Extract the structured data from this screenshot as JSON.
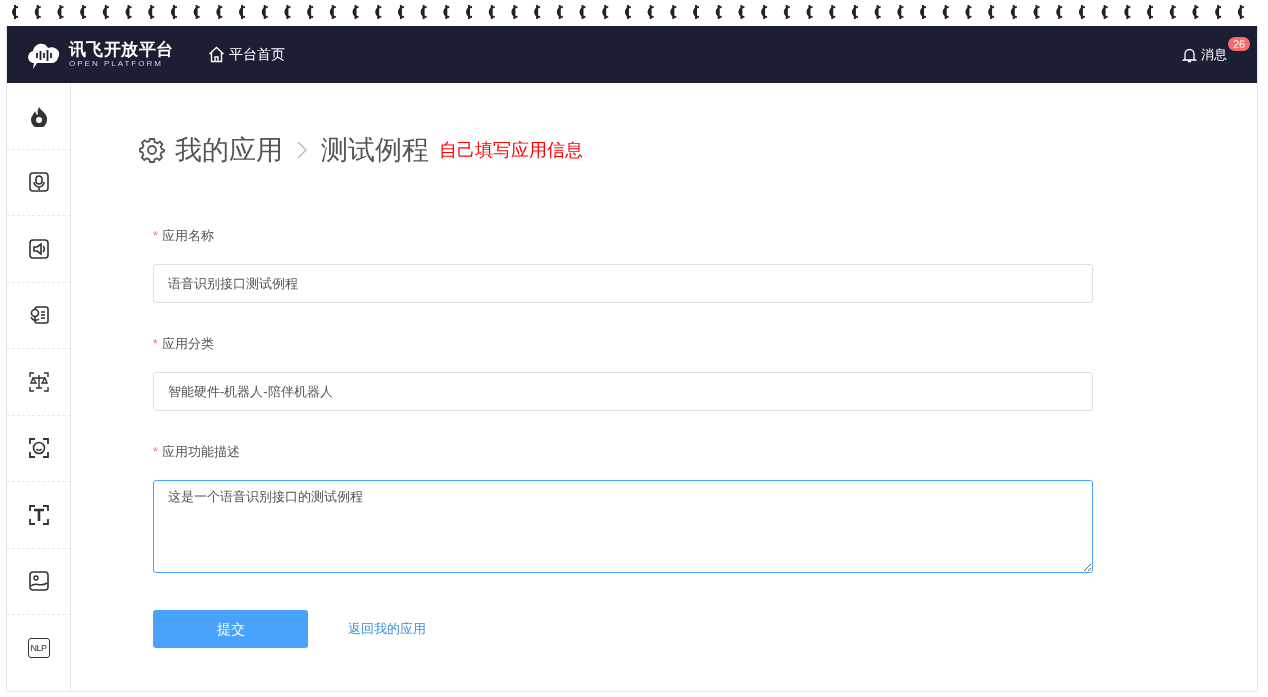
{
  "header": {
    "logo_title": "讯飞开放平台",
    "logo_subtitle": "OPEN PLATFORM",
    "home_link": "平台首页",
    "messages_label": "消息",
    "messages_count": "26"
  },
  "sidebar": {
    "items": [
      {
        "kind": "flame"
      },
      {
        "kind": "mic"
      },
      {
        "kind": "speaker"
      },
      {
        "kind": "voice-doc"
      },
      {
        "kind": "scale"
      },
      {
        "kind": "face"
      },
      {
        "kind": "text"
      },
      {
        "kind": "image"
      },
      {
        "kind": "nlp",
        "label": "NLP"
      }
    ]
  },
  "breadcrumb": {
    "items": [
      "我的应用",
      "测试例程"
    ],
    "annotation": "自己填写应用信息"
  },
  "form": {
    "fields": [
      {
        "label": "应用名称",
        "required": true,
        "required_marker": "*",
        "kind": "input",
        "value": "语音识别接口测试例程",
        "focused": false
      },
      {
        "label": "应用分类",
        "required": true,
        "required_marker": "*",
        "kind": "input",
        "value": "智能硬件-机器人-陪伴机器人",
        "focused": false
      },
      {
        "label": "应用功能描述",
        "required": true,
        "required_marker": "*",
        "kind": "textarea",
        "value": "这是一个语音识别接口的测试例程",
        "focused": true
      }
    ],
    "submit": "提交",
    "back_link": "返回我的应用"
  }
}
